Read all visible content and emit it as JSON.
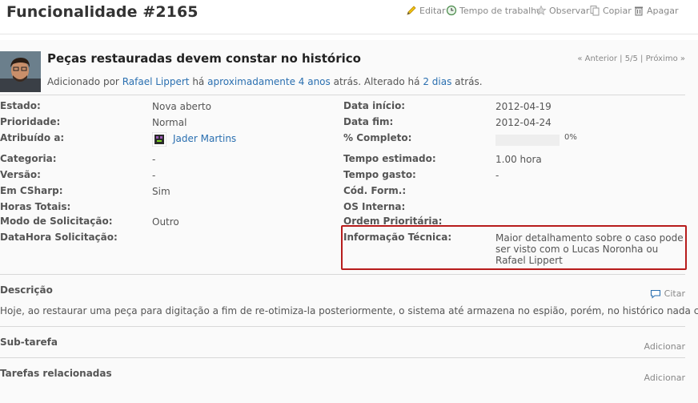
{
  "header": {
    "title": "Funcionalidade #2165",
    "actions": {
      "edit": "Editar",
      "time": "Tempo de trabalho",
      "watch": "Observar",
      "copy": "Copiar",
      "delete": "Apagar"
    }
  },
  "issue": {
    "subject": "Peças restauradas devem constar no histórico",
    "nav": {
      "prev": "« Anterior",
      "pos": "5/5",
      "next": "Próximo »",
      "sep": "|"
    },
    "author_line": {
      "added_by": "Adicionado por",
      "author": "Rafael Lippert",
      "ha": "há",
      "created": "aproximadamente 4 anos",
      "mid": "atrás. Alterado há",
      "updated": "2 dias",
      "end": "atrás."
    },
    "left_fields": [
      {
        "label": "Estado:",
        "value": "Nova aberto"
      },
      {
        "label": "Prioridade:",
        "value": "Normal"
      },
      {
        "label": "Atribuído a:",
        "value": "Jader Martins"
      },
      {
        "label": "Categoria:",
        "value": "-"
      },
      {
        "label": "Versão:",
        "value": "-"
      },
      {
        "label": "Em CSharp:",
        "value": "Sim"
      },
      {
        "label": "Horas Totais:",
        "value": ""
      },
      {
        "label": "Modo de Solicitação:",
        "value": "Outro"
      },
      {
        "label": "DataHora Solicitação:",
        "value": ""
      }
    ],
    "right_fields": [
      {
        "label": "Data início:",
        "value": "2012-04-19"
      },
      {
        "label": "Data fim:",
        "value": "2012-04-24"
      },
      {
        "label": "% Completo:",
        "value": "0%"
      },
      {
        "label": "Tempo estimado:",
        "value": "1.00 hora"
      },
      {
        "label": "Tempo gasto:",
        "value": "-"
      },
      {
        "label": "Cód. Form.:",
        "value": ""
      },
      {
        "label": "OS Interna:",
        "value": ""
      },
      {
        "label": "Ordem Prioritária:",
        "value": ""
      },
      {
        "label": "Informação Técnica:",
        "value": "Maior detalhamento sobre o caso pode ser visto com o Lucas Noronha ou Rafael Lippert"
      }
    ],
    "progress_percent": 0,
    "description": {
      "heading": "Descrição",
      "quote": "Citar",
      "text": "Hoje, ao restaurar uma peça para digitação a fim de re-otimiza-la posteriormente, o sistema até armazena no espião, porém, no histórico nada consta."
    },
    "subtasks": {
      "heading": "Sub-tarefa",
      "add": "Adicionar"
    },
    "relations": {
      "heading": "Tarefas relacionadas",
      "add": "Adicionar"
    }
  },
  "colors": {
    "link": "#2a6fb0",
    "highlight_border": "#b71c1c"
  }
}
